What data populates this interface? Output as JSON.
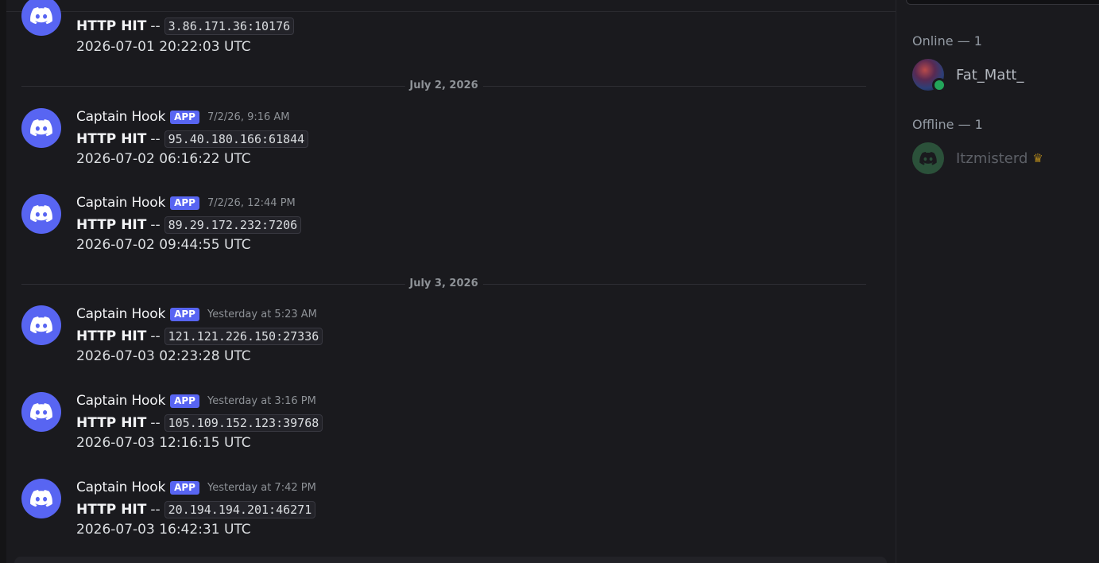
{
  "messages": [
    {
      "username": "",
      "badge": "",
      "timestamp": "",
      "label": "HTTP HIT",
      "separator": "--",
      "ip": "3.86.171.36:10176",
      "datetime": "2026-07-01 20:22:03 UTC"
    },
    {
      "username": "Captain Hook",
      "badge": "APP",
      "timestamp": "7/2/26, 9:16 AM",
      "label": "HTTP HIT",
      "separator": "--",
      "ip": "95.40.180.166:61844",
      "datetime": "2026-07-02 06:16:22 UTC"
    },
    {
      "username": "Captain Hook",
      "badge": "APP",
      "timestamp": "7/2/26, 12:44 PM",
      "label": "HTTP HIT",
      "separator": "--",
      "ip": "89.29.172.232:7206",
      "datetime": "2026-07-02 09:44:55 UTC"
    },
    {
      "username": "Captain Hook",
      "badge": "APP",
      "timestamp": "Yesterday at 5:23 AM",
      "label": "HTTP HIT",
      "separator": "--",
      "ip": "121.121.226.150:27336",
      "datetime": "2026-07-03 02:23:28 UTC"
    },
    {
      "username": "Captain Hook",
      "badge": "APP",
      "timestamp": "Yesterday at 3:16 PM",
      "label": "HTTP HIT",
      "separator": "--",
      "ip": "105.109.152.123:39768",
      "datetime": "2026-07-03 12:16:15 UTC"
    },
    {
      "username": "Captain Hook",
      "badge": "APP",
      "timestamp": "Yesterday at 7:42 PM",
      "label": "HTTP HIT",
      "separator": "--",
      "ip": "20.194.194.201:46271",
      "datetime": "2026-07-03 16:42:31 UTC"
    }
  ],
  "dividers": [
    "July 2, 2026",
    "July 3, 2026"
  ],
  "members": {
    "online_title": "Online — 1",
    "offline_title": "Offline — 1",
    "online": [
      {
        "name": "Fat_Matt_",
        "status": "online",
        "avatar_icon": "user-avatar"
      }
    ],
    "offline": [
      {
        "name": "Itzmisterd",
        "status": "offline",
        "avatar_icon": "discord-logo-icon",
        "badge_icon": "crown-icon"
      }
    ]
  },
  "colors": {
    "background": "#1a1a1e",
    "blurple": "#5865f2",
    "online_green": "#23a55a",
    "crown_gold": "#a8801c"
  }
}
